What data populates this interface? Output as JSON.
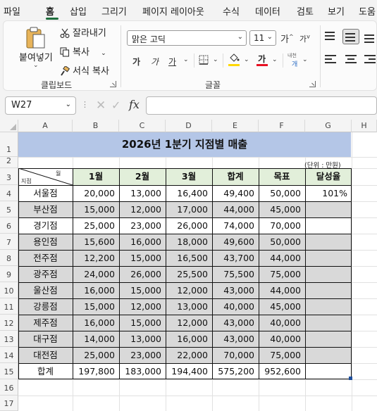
{
  "ribbon_tabs": [
    "파일",
    "홈",
    "삽입",
    "그리기",
    "페이지 레이아웃",
    "수식",
    "데이터",
    "검토",
    "보기",
    "도움"
  ],
  "active_tab": "홈",
  "clipboard": {
    "paste": "붙여넣기",
    "cut": "잘라내기",
    "copy": "복사",
    "format_painter": "서식 복사",
    "group_label": "클립보드"
  },
  "font": {
    "name": "맑은 고딕",
    "size": "11",
    "grow": "가",
    "shrink": "가",
    "bold": "가",
    "italic": "가",
    "underline": "가",
    "font_color_glyph": "가",
    "phonetic_top": "내천",
    "phonetic_bottom": "개",
    "group_label": "글꼴"
  },
  "formula_bar": {
    "name_box": "W27",
    "fx": "fx",
    "value": ""
  },
  "columns": [
    "A",
    "B",
    "C",
    "D",
    "E",
    "F",
    "G",
    "H"
  ],
  "rows": [
    "1",
    "2",
    "3",
    "4",
    "5",
    "6",
    "7",
    "8",
    "9",
    "10",
    "11",
    "12",
    "13",
    "14",
    "15",
    "16",
    "17"
  ],
  "sheet": {
    "title": "2026년 1분기 지점별 매출",
    "unit_note": "(단위 : 만원)",
    "diag_top": "월",
    "diag_bottom": "지점",
    "headers": [
      "1월",
      "2월",
      "3월",
      "합계",
      "목표",
      "달성율"
    ],
    "branches": [
      {
        "name": "서울점",
        "m1": "20,000",
        "m2": "13,000",
        "m3": "16,400",
        "sum": "49,400",
        "goal": "50,000",
        "rate": "101%"
      },
      {
        "name": "부산점",
        "m1": "15,000",
        "m2": "12,000",
        "m3": "17,000",
        "sum": "44,000",
        "goal": "45,000",
        "rate": ""
      },
      {
        "name": "경기점",
        "m1": "25,000",
        "m2": "23,000",
        "m3": "26,000",
        "sum": "74,000",
        "goal": "70,000",
        "rate": ""
      },
      {
        "name": "용인점",
        "m1": "15,600",
        "m2": "16,000",
        "m3": "18,000",
        "sum": "49,600",
        "goal": "50,000",
        "rate": ""
      },
      {
        "name": "전주점",
        "m1": "12,200",
        "m2": "15,000",
        "m3": "16,500",
        "sum": "43,700",
        "goal": "44,000",
        "rate": ""
      },
      {
        "name": "광주점",
        "m1": "24,000",
        "m2": "26,000",
        "m3": "25,500",
        "sum": "75,500",
        "goal": "75,000",
        "rate": ""
      },
      {
        "name": "울산점",
        "m1": "16,000",
        "m2": "15,000",
        "m3": "12,000",
        "sum": "43,000",
        "goal": "44,000",
        "rate": ""
      },
      {
        "name": "강릉점",
        "m1": "15,000",
        "m2": "12,000",
        "m3": "13,000",
        "sum": "40,000",
        "goal": "45,000",
        "rate": ""
      },
      {
        "name": "제주점",
        "m1": "16,000",
        "m2": "15,000",
        "m3": "12,000",
        "sum": "43,000",
        "goal": "40,000",
        "rate": ""
      },
      {
        "name": "대구점",
        "m1": "14,000",
        "m2": "13,000",
        "m3": "16,000",
        "sum": "43,000",
        "goal": "40,000",
        "rate": ""
      },
      {
        "name": "대전점",
        "m1": "25,000",
        "m2": "23,000",
        "m3": "22,000",
        "sum": "70,000",
        "goal": "75,000",
        "rate": ""
      }
    ],
    "total": {
      "name": "합계",
      "m1": "197,800",
      "m2": "183,000",
      "m3": "194,400",
      "sum": "575,200",
      "goal": "952,600",
      "rate": ""
    }
  },
  "colors": {
    "title_fill": "#b4c6e7",
    "header_fill": "#e2efda",
    "band_fill": "#d9d9d9",
    "accent": "#1e6e3c"
  }
}
